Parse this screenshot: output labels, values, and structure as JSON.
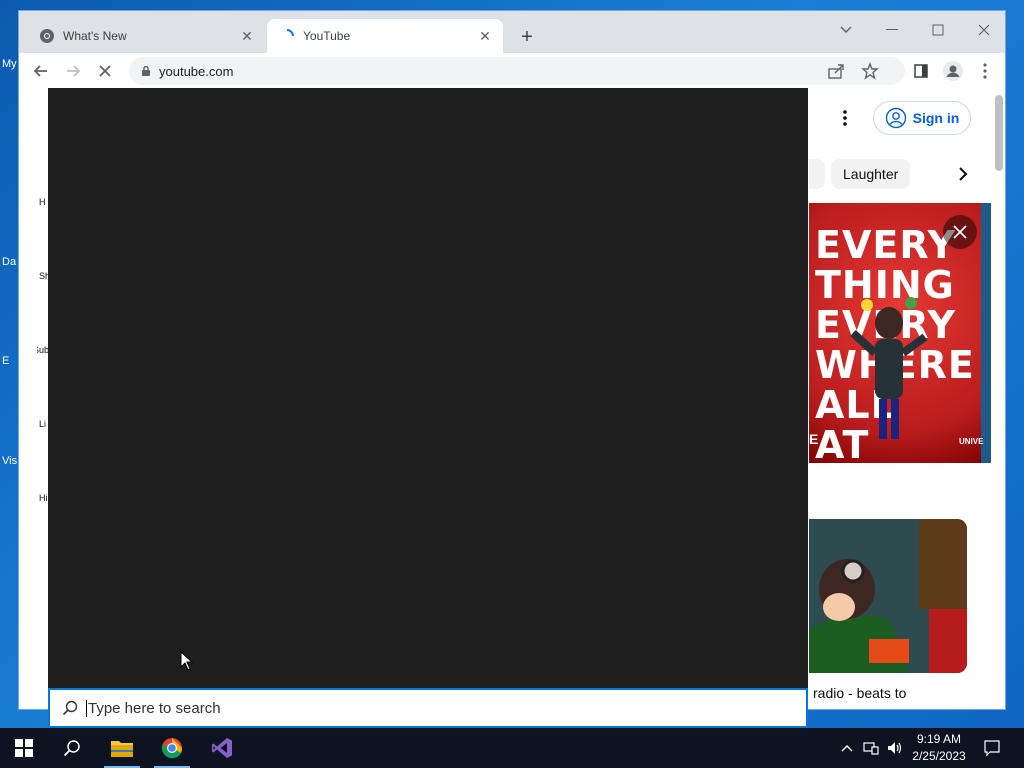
{
  "desktop": {
    "icons": [
      {
        "label": "My",
        "color": "#ffffff"
      },
      {
        "label": "Da",
        "color": "#ffffff"
      },
      {
        "label": "E",
        "color": "#ffffff"
      },
      {
        "label": "Vis",
        "color": "#ffffff"
      }
    ]
  },
  "browser": {
    "tabs": [
      {
        "title": "What's New",
        "icon": "chrome-icon",
        "active": false
      },
      {
        "title": "YouTube",
        "icon": "loading-spinner-icon",
        "active": true
      }
    ],
    "new_tab_icon": "plus-icon",
    "window_controls": [
      "tab-search-icon",
      "minimize-icon",
      "maximize-icon",
      "close-icon"
    ],
    "address": "youtube.com",
    "toolbar_icons": [
      "back-icon",
      "forward-icon",
      "stop-loading-icon",
      "share-icon",
      "bookmark-star-icon",
      "side-panel-icon",
      "profile-icon",
      "menu-icon"
    ]
  },
  "youtube": {
    "sidebar_partial": [
      {
        "label": "H"
      },
      {
        "label": "Sh"
      },
      {
        "label": "Subsc"
      },
      {
        "label": "Li"
      },
      {
        "label": "Hi"
      }
    ],
    "sign_in_label": "Sign in",
    "chips": [
      "Laughter"
    ],
    "ad_poster": {
      "text": "EVERY THING EVERY WHERE ALL AT ONCE",
      "side_text": "E",
      "corner_text": "UNIVE"
    },
    "video_title": "radio - beats to",
    "accent": "#065fd4"
  },
  "search": {
    "placeholder": "Type here to search"
  },
  "taskbar": {
    "apps": [
      "start-icon",
      "search-icon",
      "file-explorer-icon",
      "chrome-icon",
      "visual-studio-icon"
    ],
    "tray_icons": [
      "chevron-up-icon",
      "network-icon",
      "volume-icon",
      "notification-icon"
    ],
    "time": "9:19 AM",
    "date": "2/25/2023"
  }
}
